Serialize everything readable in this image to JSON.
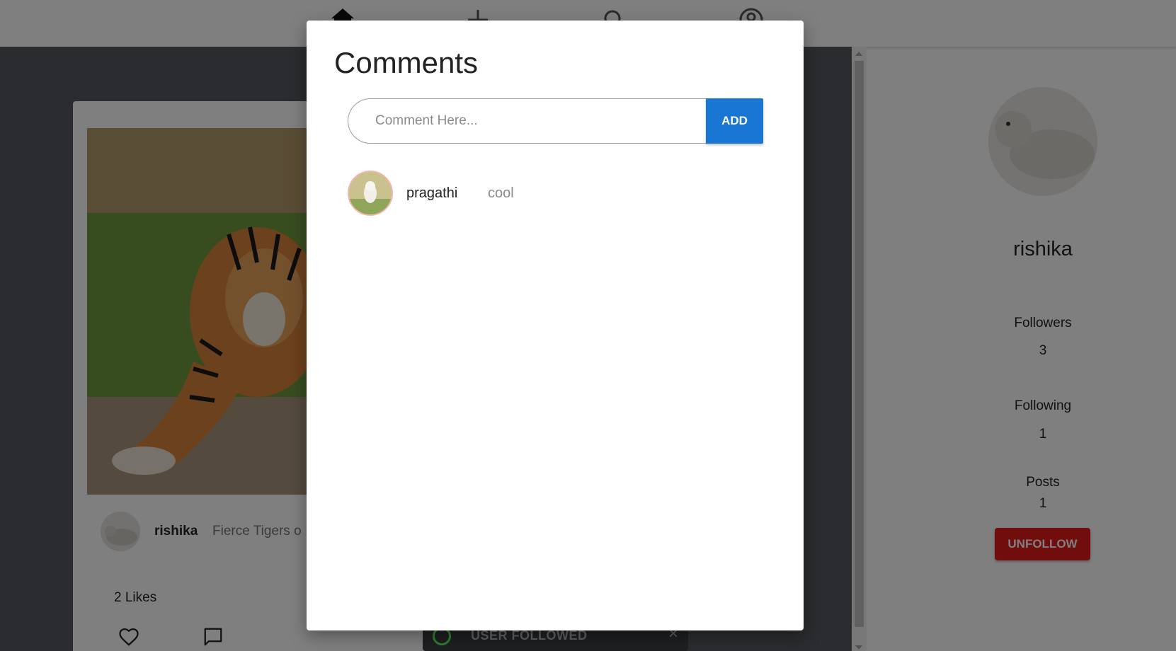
{
  "nav": {
    "icons": [
      "home-icon",
      "add-icon",
      "search-icon",
      "account-icon"
    ]
  },
  "post": {
    "image": "tiger-photo",
    "author": "rishika",
    "caption": "Fierce Tigers o",
    "likes": "2 Likes"
  },
  "profile": {
    "name": "rishika",
    "followers_label": "Followers",
    "followers_count": "3",
    "following_label": "Following",
    "following_count": "1",
    "posts_label": "Posts",
    "posts_count": "1",
    "unfollow_label": "UNFOLLOW"
  },
  "modal": {
    "title": "Comments",
    "input_placeholder": "Comment Here...",
    "input_value": "",
    "add_label": "ADD",
    "comments": [
      {
        "user": "pragathi",
        "text": "cool"
      }
    ]
  },
  "snackbar": {
    "text": "USER FOLLOWED",
    "close": "×"
  },
  "colors": {
    "primary": "#1976d2",
    "danger": "#e31b1b",
    "overlay": "rgba(0,0,0,0.5)"
  }
}
